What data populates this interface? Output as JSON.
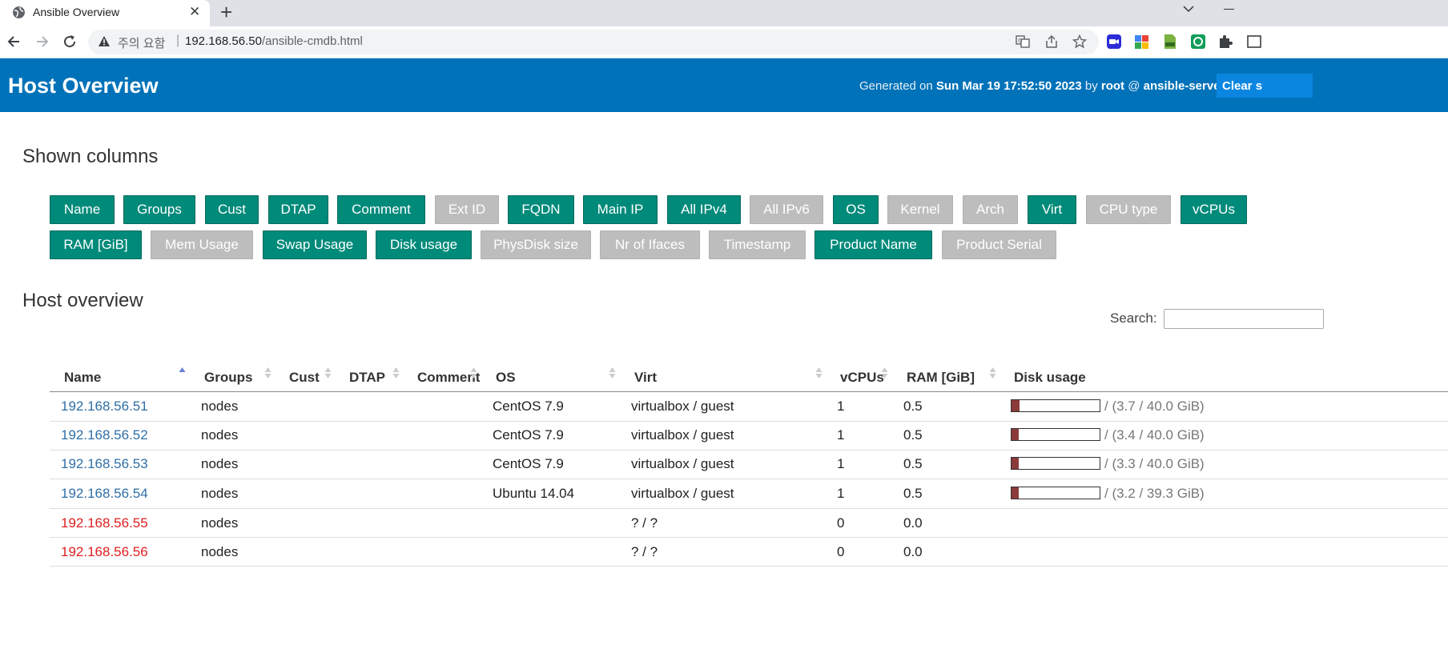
{
  "browser": {
    "tab_title": "Ansible Overview",
    "url_warning": "주의 요함",
    "url_host": "192.168.56.50",
    "url_path": "/ansible-cmdb.html"
  },
  "header": {
    "title": "Host Overview",
    "generated_prefix": "Generated on",
    "generated_date": "Sun Mar 19 17:52:50 2023",
    "by": "by",
    "user": "root",
    "at": "@",
    "server": "ansible-server",
    "clear_button": "Clear s"
  },
  "shown_columns": {
    "title": "Shown columns",
    "columns": [
      {
        "label": "Name",
        "on": true
      },
      {
        "label": "Groups",
        "on": true
      },
      {
        "label": "Cust",
        "on": true
      },
      {
        "label": "DTAP",
        "on": true
      },
      {
        "label": "Comment",
        "on": true
      },
      {
        "label": "Ext ID",
        "on": false
      },
      {
        "label": "FQDN",
        "on": true
      },
      {
        "label": "Main IP",
        "on": true
      },
      {
        "label": "All IPv4",
        "on": true
      },
      {
        "label": "All IPv6",
        "on": false
      },
      {
        "label": "OS",
        "on": true
      },
      {
        "label": "Kernel",
        "on": false
      },
      {
        "label": "Arch",
        "on": false
      },
      {
        "label": "Virt",
        "on": true
      },
      {
        "label": "CPU type",
        "on": false
      },
      {
        "label": "vCPUs",
        "on": true
      },
      {
        "label": "RAM [GiB]",
        "on": true
      },
      {
        "label": "Mem Usage",
        "on": false
      },
      {
        "label": "Swap Usage",
        "on": true
      },
      {
        "label": "Disk usage",
        "on": true
      },
      {
        "label": "PhysDisk size",
        "on": false
      },
      {
        "label": "Nr of Ifaces",
        "on": false
      },
      {
        "label": "Timestamp",
        "on": false
      },
      {
        "label": "Product Name",
        "on": true
      },
      {
        "label": "Product Serial",
        "on": false
      }
    ]
  },
  "host_overview": {
    "title": "Host overview",
    "search_label": "Search:",
    "search_value": "",
    "headers": [
      "Name",
      "Groups",
      "Cust",
      "DTAP",
      "Comment",
      "OS",
      "Virt",
      "vCPUs",
      "RAM [GiB]",
      "Disk usage"
    ],
    "rows": [
      {
        "name": "192.168.56.51",
        "groups": "nodes",
        "os": "CentOS 7.9",
        "virt": "virtualbox / guest",
        "vcpus": "1",
        "ram": "0.5",
        "disk": "/ (3.7 / 40.0 GiB)",
        "disk_fraction": 0.09,
        "status": "up"
      },
      {
        "name": "192.168.56.52",
        "groups": "nodes",
        "os": "CentOS 7.9",
        "virt": "virtualbox / guest",
        "vcpus": "1",
        "ram": "0.5",
        "disk": "/ (3.4 / 40.0 GiB)",
        "disk_fraction": 0.085,
        "status": "up"
      },
      {
        "name": "192.168.56.53",
        "groups": "nodes",
        "os": "CentOS 7.9",
        "virt": "virtualbox / guest",
        "vcpus": "1",
        "ram": "0.5",
        "disk": "/ (3.3 / 40.0 GiB)",
        "disk_fraction": 0.083,
        "status": "up"
      },
      {
        "name": "192.168.56.54",
        "groups": "nodes",
        "os": "Ubuntu 14.04",
        "virt": "virtualbox / guest",
        "vcpus": "1",
        "ram": "0.5",
        "disk": "/ (3.2 / 39.3 GiB)",
        "disk_fraction": 0.081,
        "status": "up"
      },
      {
        "name": "192.168.56.55",
        "groups": "nodes",
        "os": "",
        "virt": "? / ?",
        "vcpus": "0",
        "ram": "0.0",
        "disk": "",
        "disk_fraction": null,
        "status": "down"
      },
      {
        "name": "192.168.56.56",
        "groups": "nodes",
        "os": "",
        "virt": "? / ?",
        "vcpus": "0",
        "ram": "0.0",
        "disk": "",
        "disk_fraction": null,
        "status": "down"
      }
    ]
  },
  "colors": {
    "header_bg": "#0072b9",
    "column_on": "#008a7a",
    "column_off": "#bdbdbd",
    "host_link": "#2f6fa7",
    "host_down": "#e02020",
    "disk_fill": "#8b3a3a"
  }
}
